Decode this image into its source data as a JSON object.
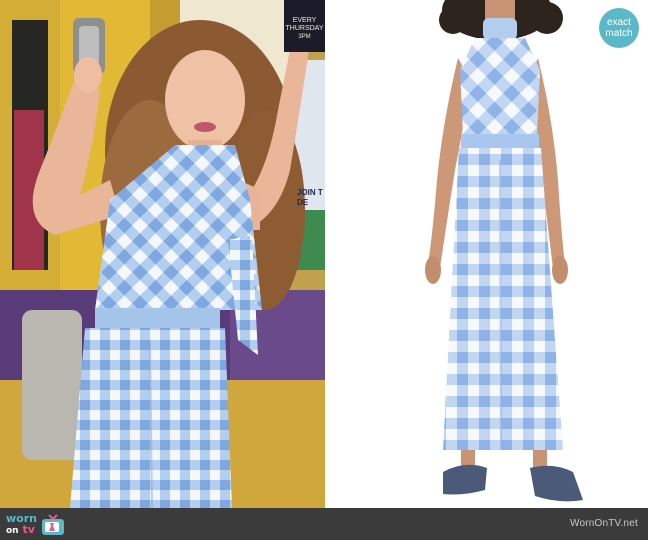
{
  "badge": {
    "line1": "exact",
    "line2": "match"
  },
  "left_photo": {
    "poster_top_line1": "EVERY THURSDAY",
    "poster_top_line2": "3PM",
    "poster_side_line1": "JOIN T",
    "poster_side_line2": "DE"
  },
  "footer": {
    "logo_worn": "worn",
    "logo_on": "on",
    "logo_tv": "tv",
    "watermark": "WornOnTV.net"
  },
  "colors": {
    "gingham_blue": "#9cc0ea",
    "gingham_light": "#d8e6f7",
    "badge": "#5bb8c6",
    "footer": "#3b3b3b",
    "locker_yellow": "#caa230",
    "locker_purple": "#5a3b7a"
  }
}
